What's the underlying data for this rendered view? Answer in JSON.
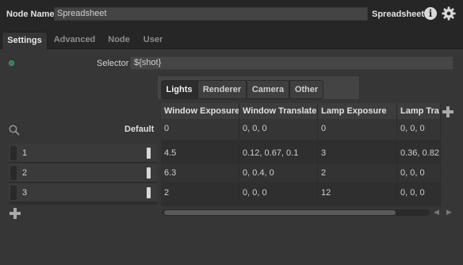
{
  "header": {
    "node_name_label": "Node Name",
    "node_name_value": "Spreadsheet",
    "node_type": "Spreadsheet"
  },
  "tabs": [
    {
      "label": "Settings",
      "active": true
    },
    {
      "label": "Advanced"
    },
    {
      "label": "Node"
    },
    {
      "label": "User"
    }
  ],
  "selector": {
    "label": "Selector",
    "value": "${shot}"
  },
  "category_tabs": [
    {
      "label": "Lights",
      "active": true
    },
    {
      "label": "Renderer"
    },
    {
      "label": "Camera"
    },
    {
      "label": "Other"
    }
  ],
  "table": {
    "columns": [
      "Window Exposure",
      "Window Translate",
      "Lamp Exposure",
      "Lamp Tra"
    ],
    "default_label": "Default",
    "default_row": [
      "0",
      "0, 0, 0",
      "0",
      "0, 0, 0"
    ],
    "rows": [
      {
        "num": "1",
        "cells": [
          "4.5",
          "0.12, 0.67, 0.1",
          "3",
          "0.36, 0.82,"
        ]
      },
      {
        "num": "2",
        "cells": [
          "6.3",
          "0, 0.4, 0",
          "2",
          "0, 0, 0"
        ]
      },
      {
        "num": "3",
        "cells": [
          "2",
          "0, 0, 0",
          "12",
          "0, 0, 0"
        ]
      }
    ]
  },
  "colors": {
    "accent_green": "#2f7a52",
    "panel": "#363636"
  }
}
